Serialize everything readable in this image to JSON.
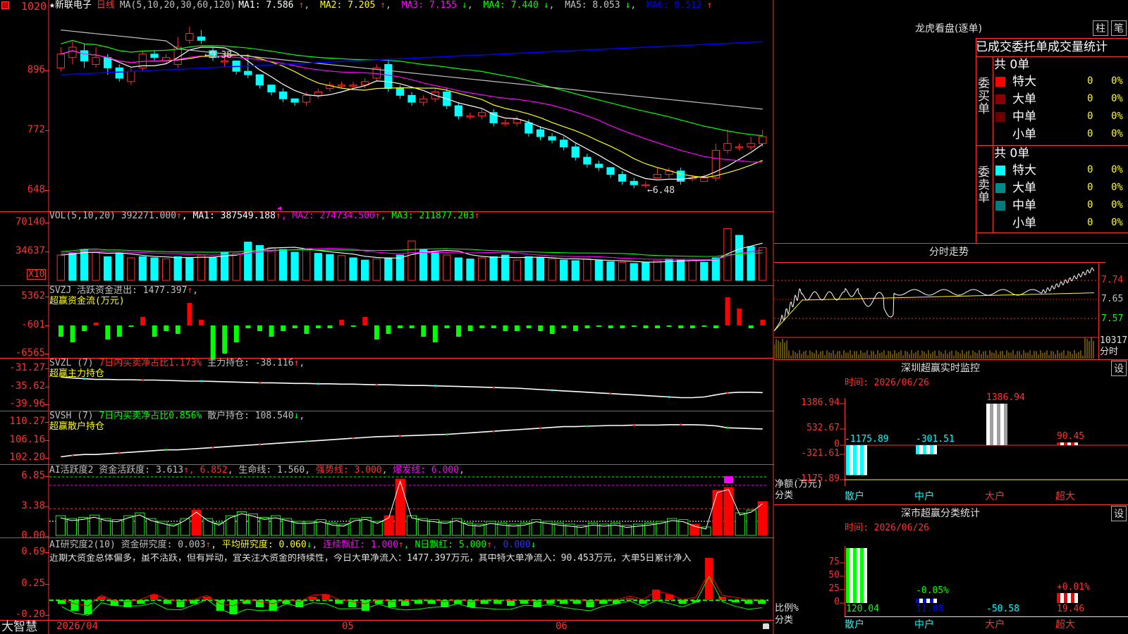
{
  "app": {
    "brand": "大智慧",
    "axis_top_label": "1020",
    "date_labels": [
      "2026/04",
      "05",
      "06"
    ]
  },
  "kline": {
    "header": {
      "star": "★",
      "stock_name": "新联电子",
      "period": "日线",
      "ma_label": "MA(5,10,20,30,60,120)",
      "ma": [
        {
          "text": "MA1: 7.586",
          "arrow": "↑",
          "color": "#ffffff"
        },
        {
          "text": "MA2: 7.205",
          "arrow": "↑",
          "color": "#ffff00"
        },
        {
          "text": "MA3: 7.155",
          "arrow": "↓",
          "color": "#ff00ff"
        },
        {
          "text": "MA4: 7.440",
          "arrow": "↓",
          "color": "#00ff00"
        },
        {
          "text": "MA5: 8.053",
          "arrow": "↓",
          "color": "#c0c0c0"
        },
        {
          "text": "MA6: 8.512",
          "arrow": "↑",
          "color": "#0000ff"
        }
      ]
    },
    "y_ticks": [
      "1020",
      "896",
      "772",
      "648"
    ],
    "annotations": {
      "high": "9.38",
      "low": "6.48"
    }
  },
  "vol": {
    "header": [
      {
        "text": "VOL(5,10,20)",
        "color": "#c0c0c0"
      },
      {
        "text": " 392271.000",
        "color": "#c0c0c0"
      },
      {
        "text": "↑",
        "color": "#ff3030"
      },
      {
        "text": ", MA1: 387549.188",
        "color": "#ffffff"
      },
      {
        "text": "↑",
        "color": "#ff3030"
      },
      {
        "text": ", MA2: 274734.500",
        "color": "#ff00ff"
      },
      {
        "text": "↑",
        "color": "#ff3030"
      },
      {
        "text": ", MA3: 211877.203",
        "color": "#00ff00"
      },
      {
        "text": "↑",
        "color": "#ff3030"
      }
    ],
    "y_ticks": [
      "70140",
      "34637"
    ],
    "unit": "X10"
  },
  "svzj": {
    "header_line1": [
      {
        "text": "SVZJ  活跃资金进出: 1477.397",
        "color": "#c0c0c0"
      },
      {
        "text": "↑",
        "color": "#ff3030"
      },
      {
        "text": ",",
        "color": "#c0c0c0"
      }
    ],
    "header_line2": "超赢资金流(万元)",
    "y_ticks": [
      "5362",
      "-601",
      "-6565"
    ]
  },
  "svzl": {
    "header_line1": [
      {
        "text": "SVZL (7) ",
        "color": "#c0c0c0"
      },
      {
        "text": "7日内买卖净占比1.173%",
        "color": "#ff3030"
      },
      {
        "text": " 主力持仓: -38.116",
        "color": "#c0c0c0"
      },
      {
        "text": "↑",
        "color": "#ff3030"
      },
      {
        "text": ",",
        "color": "#c0c0c0"
      }
    ],
    "header_line2": "超赢主力持仓",
    "y_ticks": [
      "-31.27",
      "-35.62",
      "-39.96"
    ]
  },
  "svsh": {
    "header_line1": [
      {
        "text": "SVSH (7) ",
        "color": "#c0c0c0"
      },
      {
        "text": "7日内买卖净占比0.856%",
        "color": "#00ff00"
      },
      {
        "text": " 散户持仓: 108.540",
        "color": "#c0c0c0"
      },
      {
        "text": "↓",
        "color": "#00ff00"
      },
      {
        "text": ",",
        "color": "#c0c0c0"
      }
    ],
    "header_line2": "超赢散户持仓",
    "y_ticks": [
      "110.27",
      "106.16",
      "102.20"
    ]
  },
  "ai1": {
    "header": [
      {
        "text": "AI活跃度2 资金活跃度: 3.613",
        "color": "#c0c0c0"
      },
      {
        "text": "↑",
        "color": "#ff3030"
      },
      {
        "text": ", 6.852",
        "color": "#ff3030"
      },
      {
        "text": ", 生命线: 1.560",
        "color": "#c0c0c0"
      },
      {
        "text": ", ",
        "color": "#c0c0c0"
      },
      {
        "text": "强势线: 3.000",
        "color": "#ff3030"
      },
      {
        "text": ", ",
        "color": "#c0c0c0"
      },
      {
        "text": "爆发线: 6.000",
        "color": "#ff00ff"
      },
      {
        "text": ",",
        "color": "#c0c0c0"
      }
    ],
    "y_ticks": [
      "6.85",
      "3.38",
      "0.00"
    ]
  },
  "ai2": {
    "header": [
      {
        "text": "AI研究度2(10) 资金研究度: 0.003",
        "color": "#c0c0c0"
      },
      {
        "text": "↑",
        "color": "#ff3030"
      },
      {
        "text": ", 平均研究度: 0.060",
        "color": "#ffff00"
      },
      {
        "text": "↓",
        "color": "#00ff00"
      },
      {
        "text": ", ",
        "color": "#c0c0c0"
      },
      {
        "text": "连续飘红: 1.000",
        "color": "#ff00ff"
      },
      {
        "text": "↑",
        "color": "#ff3030"
      },
      {
        "text": ", N日飘红: 5.000",
        "color": "#00ff00"
      },
      {
        "text": "↑",
        "color": "#ff3030"
      },
      {
        "text": ", 0.000",
        "color": "#3030ff"
      },
      {
        "text": "↓",
        "color": "#00ff00"
      }
    ],
    "comment": "近期大资金总体偏多，虽不活跃，但有异动，宜关注大资金的持续性，今日大单净流入：1477.397万元，其中特大单净流入：90.453万元，大单5日累计净入",
    "y_ticks": [
      "0.69",
      "0.25",
      "-0.20"
    ]
  },
  "longhu": {
    "title": "龙虎看盘(逐单)",
    "btn_bar": "柱",
    "btn_pen": "笔",
    "tabs": [
      "已成交",
      "委托单",
      "成交量统计"
    ],
    "buy": {
      "side_label": [
        "委",
        "买",
        "单"
      ],
      "total": "共 0单",
      "rows": [
        {
          "label": "特大",
          "count": "0",
          "pct": "0%",
          "color": "#ff0000"
        },
        {
          "label": "大单",
          "count": "0",
          "pct": "0%",
          "color": "#8b0000"
        },
        {
          "label": "中单",
          "count": "0",
          "pct": "0%",
          "color": "#6b0000"
        },
        {
          "label": "小单",
          "count": "0",
          "pct": "0%",
          "color": ""
        }
      ]
    },
    "sell": {
      "side_label": [
        "委",
        "卖",
        "单"
      ],
      "total": "共 0单",
      "rows": [
        {
          "label": "特大",
          "count": "0",
          "pct": "0%",
          "color": "#00ffff"
        },
        {
          "label": "大单",
          "count": "0",
          "pct": "0%",
          "color": "#008b8b"
        },
        {
          "label": "中单",
          "count": "0",
          "pct": "0%",
          "color": "#007b7b"
        },
        {
          "label": "小单",
          "count": "0",
          "pct": "0%",
          "color": ""
        }
      ]
    }
  },
  "intraday": {
    "title": "分时走势",
    "y_ticks": [
      "7.74",
      "7.65",
      "7.57"
    ],
    "vol_value": "10317",
    "vol_unit": "分时"
  },
  "sz_monitor": {
    "title": "深圳超赢实时监控",
    "set_btn": "设",
    "date": "时间: 2026/06/26",
    "y_ticks": [
      "1386.94",
      "532.67",
      "0",
      "-321.61",
      "-1175.89"
    ],
    "y_label_top": "净额(万元)",
    "y_label_bottom": "分类",
    "categories": [
      "散户",
      "中户",
      "大户",
      "超大"
    ],
    "values": [
      -1175.89,
      -301.51,
      1386.94,
      90.45
    ],
    "value_labels": [
      "-1175.89",
      "-301.51",
      "1386.94",
      "90.45"
    ]
  },
  "sz_class": {
    "title": "深市超赢分类统计",
    "set_btn": "设",
    "date": "时间: 2026/06/26",
    "y_ticks": [
      "75",
      "50",
      "25",
      "0"
    ],
    "y_label_top": "比例%",
    "y_label_bottom": "分类",
    "categories": [
      "散户",
      "中户",
      "大户",
      "超大"
    ],
    "bottom_values": [
      "120.04",
      "11.08",
      "-50.58",
      "19.46"
    ],
    "top_labels": [
      "",
      "-0.05%",
      "",
      "+0.01%"
    ],
    "bar_pcts": [
      100,
      8,
      0,
      18
    ]
  },
  "chart_data": [
    {
      "type": "candlestick",
      "title": "新联电子 日线",
      "y_ticks": [
        "1020",
        "896",
        "772",
        "648"
      ],
      "x_labels": [
        "2026/04",
        "05",
        "06"
      ],
      "ma": {
        "MA1": 7.586,
        "MA2": 7.205,
        "MA3": 7.155,
        "MA4": 7.44,
        "MA5": 8.053,
        "MA6": 8.512
      },
      "high_mark": 9.38,
      "low_mark": 6.48,
      "candles": [
        [
          0.84,
          0.88,
          0.9,
          0.83
        ],
        [
          0.87,
          0.9,
          0.92,
          0.85
        ],
        [
          0.89,
          0.86,
          0.91,
          0.84
        ],
        [
          0.85,
          0.87,
          0.9,
          0.84
        ],
        [
          0.87,
          0.84,
          0.88,
          0.82
        ],
        [
          0.84,
          0.81,
          0.85,
          0.8
        ],
        [
          0.8,
          0.83,
          0.84,
          0.79
        ],
        [
          0.84,
          0.88,
          0.89,
          0.83
        ],
        [
          0.88,
          0.87,
          0.89,
          0.86
        ],
        [
          0.86,
          0.87,
          0.88,
          0.85
        ],
        [
          0.85,
          0.9,
          0.93,
          0.84
        ],
        [
          0.92,
          0.94,
          0.96,
          0.91
        ],
        [
          0.93,
          0.92,
          0.95,
          0.91
        ],
        [
          0.89,
          0.87,
          0.9,
          0.86
        ],
        [
          0.86,
          0.86,
          0.88,
          0.84
        ],
        [
          0.86,
          0.83,
          0.86,
          0.82
        ],
        [
          0.83,
          0.82,
          0.88,
          0.81
        ],
        [
          0.82,
          0.79,
          0.82,
          0.78
        ],
        [
          0.79,
          0.77,
          0.79,
          0.76
        ],
        [
          0.77,
          0.75,
          0.78,
          0.74
        ],
        [
          0.75,
          0.74,
          0.75,
          0.73
        ],
        [
          0.74,
          0.76,
          0.77,
          0.73
        ],
        [
          0.76,
          0.77,
          0.78,
          0.75
        ],
        [
          0.78,
          0.79,
          0.8,
          0.77
        ],
        [
          0.79,
          0.79,
          0.8,
          0.78
        ],
        [
          0.79,
          0.79,
          0.8,
          0.78
        ],
        [
          0.79,
          0.8,
          0.81,
          0.78
        ],
        [
          0.81,
          0.84,
          0.85,
          0.8
        ],
        [
          0.85,
          0.78,
          0.86,
          0.77
        ],
        [
          0.78,
          0.76,
          0.79,
          0.75
        ],
        [
          0.76,
          0.74,
          0.77,
          0.73
        ],
        [
          0.74,
          0.75,
          0.76,
          0.73
        ],
        [
          0.75,
          0.77,
          0.78,
          0.74
        ],
        [
          0.77,
          0.73,
          0.78,
          0.72
        ],
        [
          0.73,
          0.7,
          0.74,
          0.69
        ],
        [
          0.7,
          0.7,
          0.71,
          0.69
        ],
        [
          0.7,
          0.71,
          0.72,
          0.69
        ],
        [
          0.71,
          0.68,
          0.72,
          0.67
        ],
        [
          0.68,
          0.68,
          0.69,
          0.67
        ],
        [
          0.68,
          0.69,
          0.7,
          0.67
        ],
        [
          0.68,
          0.65,
          0.69,
          0.64
        ],
        [
          0.66,
          0.64,
          0.67,
          0.63
        ],
        [
          0.64,
          0.63,
          0.65,
          0.62
        ],
        [
          0.63,
          0.61,
          0.64,
          0.6
        ],
        [
          0.61,
          0.58,
          0.62,
          0.57
        ],
        [
          0.58,
          0.56,
          0.59,
          0.55
        ],
        [
          0.56,
          0.55,
          0.57,
          0.54
        ],
        [
          0.55,
          0.53,
          0.55,
          0.52
        ],
        [
          0.53,
          0.51,
          0.54,
          0.5
        ],
        [
          0.51,
          0.5,
          0.52,
          0.49
        ],
        [
          0.5,
          0.5,
          0.51,
          0.49
        ],
        [
          0.52,
          0.53,
          0.55,
          0.52
        ],
        [
          0.53,
          0.54,
          0.55,
          0.52
        ],
        [
          0.54,
          0.51,
          0.55,
          0.5
        ],
        [
          0.52,
          0.52,
          0.53,
          0.51
        ],
        [
          0.51,
          0.52,
          0.53,
          0.51
        ],
        [
          0.52,
          0.6,
          0.62,
          0.51
        ],
        [
          0.6,
          0.62,
          0.66,
          0.59
        ],
        [
          0.61,
          0.61,
          0.62,
          0.6
        ],
        [
          0.61,
          0.62,
          0.64,
          0.6
        ],
        [
          0.62,
          0.64,
          0.66,
          0.61
        ]
      ]
    },
    {
      "type": "bar",
      "title": "VOL(5,10,20)",
      "values": [
        0.45,
        0.48,
        0.55,
        0.5,
        0.42,
        0.48,
        0.4,
        0.42,
        0.4,
        0.38,
        0.42,
        0.4,
        0.45,
        0.4,
        0.5,
        0.48,
        0.68,
        0.62,
        0.58,
        0.55,
        0.5,
        0.55,
        0.48,
        0.46,
        0.44,
        0.4,
        0.36,
        0.38,
        0.4,
        0.45,
        0.7,
        0.55,
        0.5,
        0.45,
        0.4,
        0.38,
        0.4,
        0.42,
        0.45,
        0.36,
        0.42,
        0.4,
        0.38,
        0.36,
        0.35,
        0.38,
        0.35,
        0.33,
        0.32,
        0.3,
        0.32,
        0.35,
        0.38,
        0.36,
        0.35,
        0.32,
        0.4,
        0.92,
        0.8,
        0.6,
        0.58
      ]
    },
    {
      "type": "bar",
      "title": "SVZJ 活跃资金进出",
      "values": [
        -0.4,
        -0.6,
        -0.2,
        0.1,
        -0.5,
        -0.4,
        -0.05,
        0.3,
        -0.4,
        -0.2,
        -0.3,
        0.8,
        0.2,
        -1.2,
        -1.0,
        -0.6,
        -0.1,
        -0.2,
        -0.4,
        -0.2,
        -0.1,
        -0.3,
        -0.1,
        -0.1,
        0.2,
        -0.05,
        0.3,
        -0.5,
        -0.3,
        -0.1,
        -0.1,
        -0.4,
        -0.6,
        -0.1,
        -0.4,
        -0.2,
        -0.1,
        -0.1,
        -0.2,
        -0.2,
        -0.1,
        -0.2,
        -0.3,
        -0.1,
        -0.2,
        -0.1,
        -0.05,
        -0.1,
        -0.1,
        -0.05,
        -0.1,
        -0.1,
        -0.05,
        -0.1,
        -0.1,
        -0.05,
        -0.1,
        1.0,
        0.6,
        -0.1,
        0.2
      ]
    },
    {
      "type": "line",
      "title": "SVZL 主力持仓",
      "values": [
        0.15,
        0.18,
        0.2,
        0.22,
        0.22,
        0.23,
        0.23,
        0.24,
        0.24,
        0.25,
        0.26,
        0.27,
        0.27,
        0.28,
        0.29,
        0.3,
        0.31,
        0.32,
        0.32,
        0.33,
        0.34,
        0.34,
        0.35,
        0.35,
        0.36,
        0.36,
        0.37,
        0.38,
        0.38,
        0.39,
        0.4,
        0.4,
        0.41,
        0.42,
        0.43,
        0.44,
        0.45,
        0.46,
        0.47,
        0.48,
        0.5,
        0.52,
        0.54,
        0.56,
        0.58,
        0.6,
        0.62,
        0.64,
        0.66,
        0.68,
        0.7,
        0.72,
        0.74,
        0.76,
        0.76,
        0.74,
        0.68,
        0.62,
        0.6,
        0.6,
        0.61
      ]
    },
    {
      "type": "line",
      "title": "SVSH 散户持仓",
      "values": [
        0.1,
        0.14,
        0.16,
        0.16,
        0.18,
        0.2,
        0.22,
        0.24,
        0.26,
        0.28,
        0.28,
        0.3,
        0.32,
        0.34,
        0.36,
        0.38,
        0.4,
        0.42,
        0.44,
        0.46,
        0.48,
        0.5,
        0.52,
        0.54,
        0.56,
        0.58,
        0.6,
        0.62,
        0.63,
        0.64,
        0.65,
        0.66,
        0.67,
        0.68,
        0.7,
        0.72,
        0.74,
        0.76,
        0.78,
        0.8,
        0.82,
        0.84,
        0.86,
        0.88,
        0.88,
        0.89,
        0.9,
        0.91,
        0.91,
        0.92,
        0.92,
        0.92,
        0.93,
        0.93,
        0.93,
        0.92,
        0.9,
        0.85,
        0.84,
        0.83,
        0.82
      ]
    },
    {
      "type": "bar",
      "title": "AI活跃度2 资金活跃度",
      "values": [
        0.35,
        0.3,
        0.32,
        0.36,
        0.3,
        0.28,
        0.35,
        0.4,
        0.3,
        0.25,
        0.2,
        0.3,
        0.45,
        0.3,
        0.22,
        0.35,
        0.42,
        0.38,
        0.32,
        0.35,
        0.3,
        0.25,
        0.25,
        0.28,
        0.22,
        0.2,
        0.3,
        0.32,
        0.25,
        0.35,
        1.0,
        0.35,
        0.3,
        0.28,
        0.25,
        0.3,
        0.22,
        0.2,
        0.25,
        0.22,
        0.2,
        0.22,
        0.28,
        0.25,
        0.22,
        0.2,
        0.18,
        0.22,
        0.2,
        0.22,
        0.18,
        0.2,
        0.22,
        0.25,
        0.3,
        0.28,
        0.2,
        0.15,
        0.8,
        0.85,
        0.4,
        0.45,
        0.6
      ]
    },
    {
      "type": "bar",
      "title": "AI研究度2(10)",
      "values": [
        -0.05,
        -0.15,
        -0.2,
        0.05,
        -0.08,
        -0.1,
        -0.05,
        0.08,
        -0.05,
        -0.1,
        -0.05,
        0.05,
        -0.15,
        -0.2,
        -0.05,
        -0.1,
        -0.15,
        -0.05,
        -0.1,
        0.05,
        0.08,
        -0.05,
        -0.1,
        -0.15,
        -0.05,
        -0.1,
        -0.08,
        -0.05,
        -0.05,
        -0.1,
        -0.05,
        -0.1,
        -0.05,
        -0.05,
        -0.08,
        -0.05,
        -0.1,
        -0.05,
        -0.05,
        -0.05,
        -0.1,
        -0.05,
        -0.05,
        0.03,
        -0.05,
        0.15,
        0.08,
        -0.05,
        0.0,
        0.6,
        0.05,
        0.0,
        -0.05,
        -0.05
      ]
    }
  ]
}
